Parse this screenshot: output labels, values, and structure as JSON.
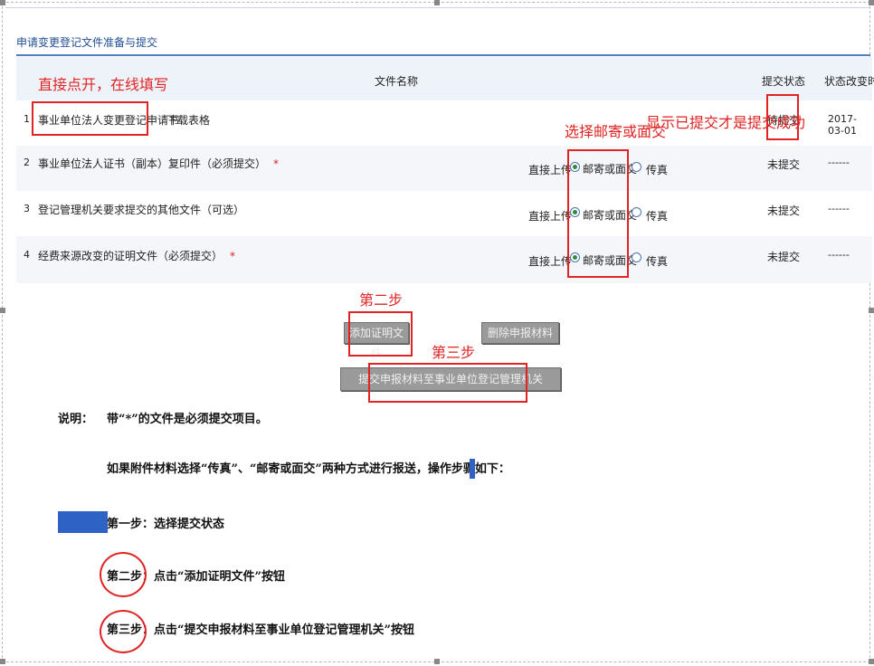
{
  "panel": {
    "title": "申请变更登记文件准备与提交"
  },
  "table": {
    "headers": {
      "file_name": "文件名称",
      "submit_status": "提交状态",
      "status_time": "状态改变时间"
    },
    "rows": [
      {
        "num": "1",
        "name": "事业单位法人变更登记申请书",
        "required": false,
        "extra": "下载表格",
        "status": "待提交",
        "time": "2017-03-01"
      },
      {
        "num": "2",
        "name": "事业单位法人证书（副本）复印件（必须提交）",
        "required": true,
        "upload": "直接上传",
        "opt_mail": "邮寄或面交",
        "opt_fax": "传真",
        "status": "未提交",
        "time": "------"
      },
      {
        "num": "3",
        "name": "登记管理机关要求提交的其他文件（可选）",
        "required": false,
        "upload": "直接上传",
        "opt_mail": "邮寄或面交",
        "opt_fax": "传真",
        "status": "未提交",
        "time": "------"
      },
      {
        "num": "4",
        "name": "经费来源改变的证明文件（必须提交）",
        "required": true,
        "upload": "直接上传",
        "opt_mail": "邮寄或面交",
        "opt_fax": "传真",
        "status": "未提交",
        "time": "------"
      }
    ],
    "required_mark": "*"
  },
  "buttons": {
    "add_proof": "添加证明文件",
    "delete_material": "删除申报材料",
    "submit_material": "提交申报材料至事业单位登记管理机关"
  },
  "annotations": {
    "open_online": "直接点开，在线填写",
    "choose_mail": "选择邮寄或面交",
    "submitted_success": "显示已提交才是提交成功",
    "step_two": "第二步",
    "step_three": "第三步"
  },
  "notes": {
    "intro_label": "说明：",
    "intro_text": "带“*”的文件是必须提交项目。",
    "method": "如果附件材料选择“传真”、“邮寄或面交”两种方式进行报送，操作步骤如下：",
    "step1": "第一步：选择提交状态",
    "step2": "第二步：点击“添加证明文件”按钮",
    "step3": "第三步：点击“提交申报材料至事业单位登记管理机关”按钮"
  },
  "colors": {
    "accent_blue": "#2e63c5",
    "annotation_red": "#e02323",
    "radio_selected": "#2e8b3a"
  }
}
